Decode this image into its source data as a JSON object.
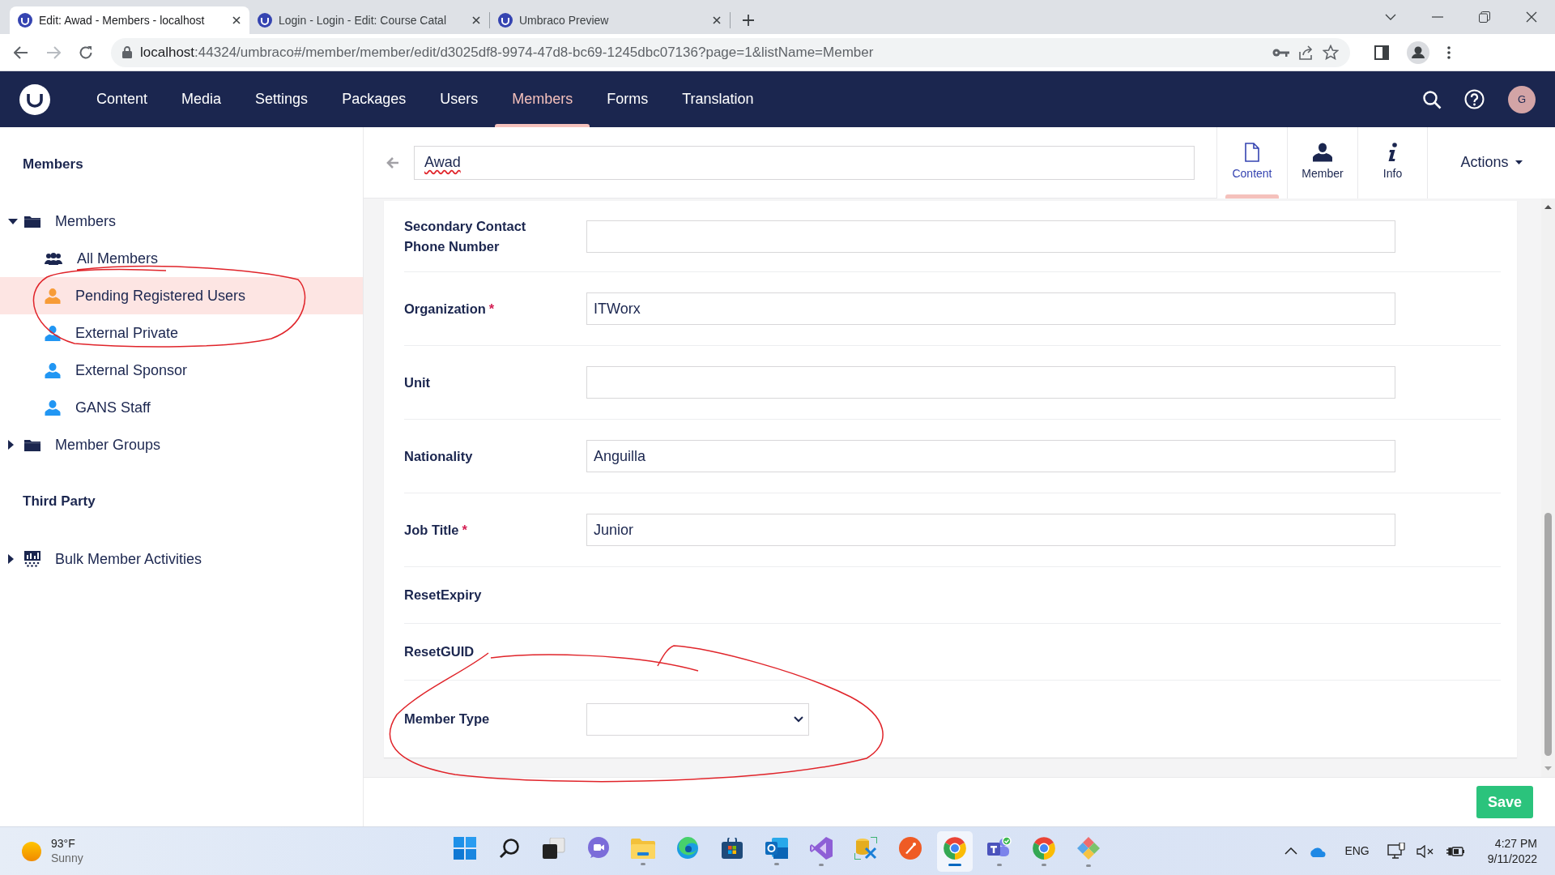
{
  "browser": {
    "tabs": [
      {
        "title": "Edit: Awad - Members - localhost",
        "selected": true
      },
      {
        "title": "Login - Login - Edit: Course Catal",
        "selected": false
      },
      {
        "title": "Umbraco Preview",
        "selected": false
      }
    ],
    "address": {
      "host": "localhost",
      "rest": ":44324/umbraco#/member/member/edit/d3025df8-9974-47d8-bc69-1245dbc07136?page=1&listName=Member"
    },
    "forward_disabled": true
  },
  "nav": {
    "items": [
      {
        "label": "Content",
        "selected": false
      },
      {
        "label": "Media",
        "selected": false
      },
      {
        "label": "Settings",
        "selected": false
      },
      {
        "label": "Packages",
        "selected": false
      },
      {
        "label": "Users",
        "selected": false
      },
      {
        "label": "Members",
        "selected": true
      },
      {
        "label": "Forms",
        "selected": false
      },
      {
        "label": "Translation",
        "selected": false
      }
    ],
    "avatar": "G"
  },
  "sidebar": {
    "sections": [
      {
        "title": "Members",
        "nodes": [
          {
            "label": "Members",
            "kind": "folder",
            "expanded": true,
            "selected": false,
            "children": [
              {
                "label": "All Members",
                "kind": "users",
                "color": "#1b264f",
                "selected": false
              },
              {
                "label": "Pending Registered Users",
                "kind": "user",
                "color": "#f79c37",
                "selected": true
              },
              {
                "label": "External Private",
                "kind": "user",
                "color": "#2196f3",
                "selected": false
              },
              {
                "label": "External Sponsor",
                "kind": "user",
                "color": "#2196f3",
                "selected": false
              },
              {
                "label": "GANS Staff",
                "kind": "user",
                "color": "#2196f3",
                "selected": false
              }
            ]
          },
          {
            "label": "Member Groups",
            "kind": "folder",
            "expanded": false,
            "selected": false
          }
        ]
      },
      {
        "title": "Third Party",
        "nodes": [
          {
            "label": "Bulk Member Activities",
            "kind": "chart",
            "expanded": false,
            "selected": false
          }
        ]
      }
    ]
  },
  "editor": {
    "name": "Awad",
    "name_misspelled": true,
    "apps": [
      {
        "label": "Content",
        "kind": "document",
        "selected": true
      },
      {
        "label": "Member",
        "kind": "person",
        "selected": false
      },
      {
        "label": "Info",
        "kind": "info",
        "selected": false
      }
    ],
    "actions": "Actions",
    "fields": [
      {
        "label": "Secondary Contact Phone Number",
        "kind": "text"
      },
      {
        "label": "Organization",
        "kind": "text",
        "required_mark": "*",
        "value": "ITWorx"
      },
      {
        "label": "Unit",
        "kind": "text"
      },
      {
        "label": "Nationality",
        "kind": "text",
        "value": "Anguilla"
      },
      {
        "label": "Job Title",
        "kind": "text",
        "required_mark": "*",
        "value": "Junior"
      },
      {
        "label": "ResetExpiry",
        "kind": "label"
      },
      {
        "label": "ResetGUID",
        "kind": "label"
      },
      {
        "label": "Member Type",
        "kind": "select"
      }
    ],
    "save": "Save"
  },
  "taskbar": {
    "weather": {
      "temp": "93°F",
      "condition": "Sunny"
    },
    "apps": [
      {
        "kind": "start",
        "running": false,
        "selected": false
      },
      {
        "kind": "search",
        "running": false,
        "selected": false
      },
      {
        "kind": "taskview",
        "running": false,
        "selected": false
      },
      {
        "kind": "chat",
        "running": false,
        "selected": false
      },
      {
        "kind": "folder",
        "running": true,
        "selected": false
      },
      {
        "kind": "swirl",
        "running": false,
        "selected": false
      },
      {
        "kind": "store",
        "running": false,
        "selected": false
      },
      {
        "kind": "mail",
        "running": true,
        "selected": false
      },
      {
        "kind": "ribbon",
        "running": true,
        "selected": false
      },
      {
        "kind": "tools",
        "running": false,
        "selected": false
      },
      {
        "kind": "rocket",
        "running": false,
        "selected": false
      },
      {
        "kind": "browser",
        "running": true,
        "selected": true
      },
      {
        "kind": "people",
        "running": true,
        "selected": false
      },
      {
        "kind": "browser",
        "running": true,
        "selected": false
      },
      {
        "kind": "diamond",
        "running": true,
        "selected": false
      }
    ],
    "language": "ENG",
    "time": "4:27 PM",
    "date": "9/11/2022"
  }
}
